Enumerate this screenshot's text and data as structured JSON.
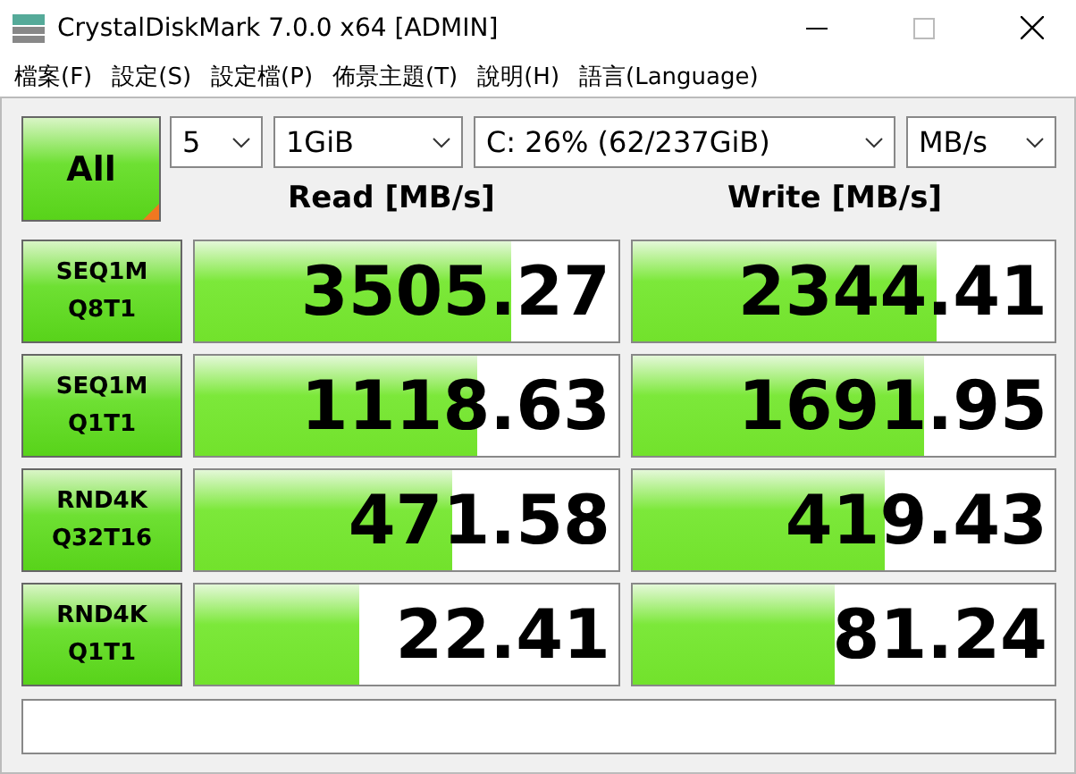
{
  "window": {
    "title": "CrystalDiskMark 7.0.0 x64 [ADMIN]"
  },
  "menu": [
    "檔案(F)",
    "設定(S)",
    "設定檔(P)",
    "佈景主題(T)",
    "說明(H)",
    "語言(Language)"
  ],
  "all_button": {
    "label": "All"
  },
  "selectors": [
    {
      "value": "5"
    },
    {
      "value": "1GiB"
    },
    {
      "value": "C: 26% (62/237GiB)"
    },
    {
      "value": "MB/s"
    }
  ],
  "columns": [
    "Read [MB/s]",
    "Write [MB/s]"
  ],
  "tests": [
    {
      "label_1": "SEQ1M",
      "label_2": "Q8T1",
      "read": {
        "value": "3505.27",
        "level": 0.75
      },
      "write": {
        "value": "2344.41",
        "level": 0.72
      }
    },
    {
      "label_1": "SEQ1M",
      "label_2": "Q1T1",
      "read": {
        "value": "1118.63",
        "level": 0.67
      },
      "write": {
        "value": "1691.95",
        "level": 0.69
      }
    },
    {
      "label_1": "RND4K",
      "label_2": "Q32T16",
      "read": {
        "value": "471.58",
        "level": 0.61
      },
      "write": {
        "value": "419.43",
        "level": 0.6
      }
    },
    {
      "label_1": "RND4K",
      "label_2": "Q1T1",
      "read": {
        "value": "22.41",
        "level": 0.39
      },
      "write": {
        "value": "81.24",
        "level": 0.48
      }
    }
  ]
}
